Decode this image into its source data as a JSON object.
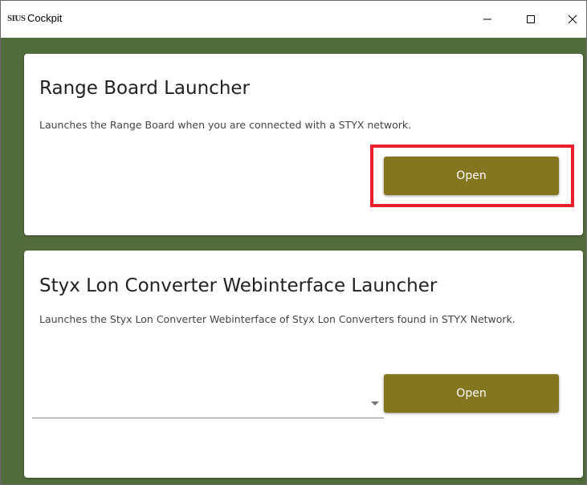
{
  "window": {
    "logo_text": "SIUS",
    "title": "Cockpit"
  },
  "cards": [
    {
      "title": "Range Board Launcher",
      "description": "Launches the Range Board when you are connected with a STYX network.",
      "button_label": "Open"
    },
    {
      "title": "Styx Lon Converter Webinterface Launcher",
      "description": "Launches the Styx Lon Converter Webinterface of Styx Lon Converters found in STYX Network.",
      "select_value": "",
      "button_label": "Open"
    }
  ],
  "colors": {
    "background": "#536c3d",
    "button": "#847520",
    "highlight": "#e8202a"
  }
}
